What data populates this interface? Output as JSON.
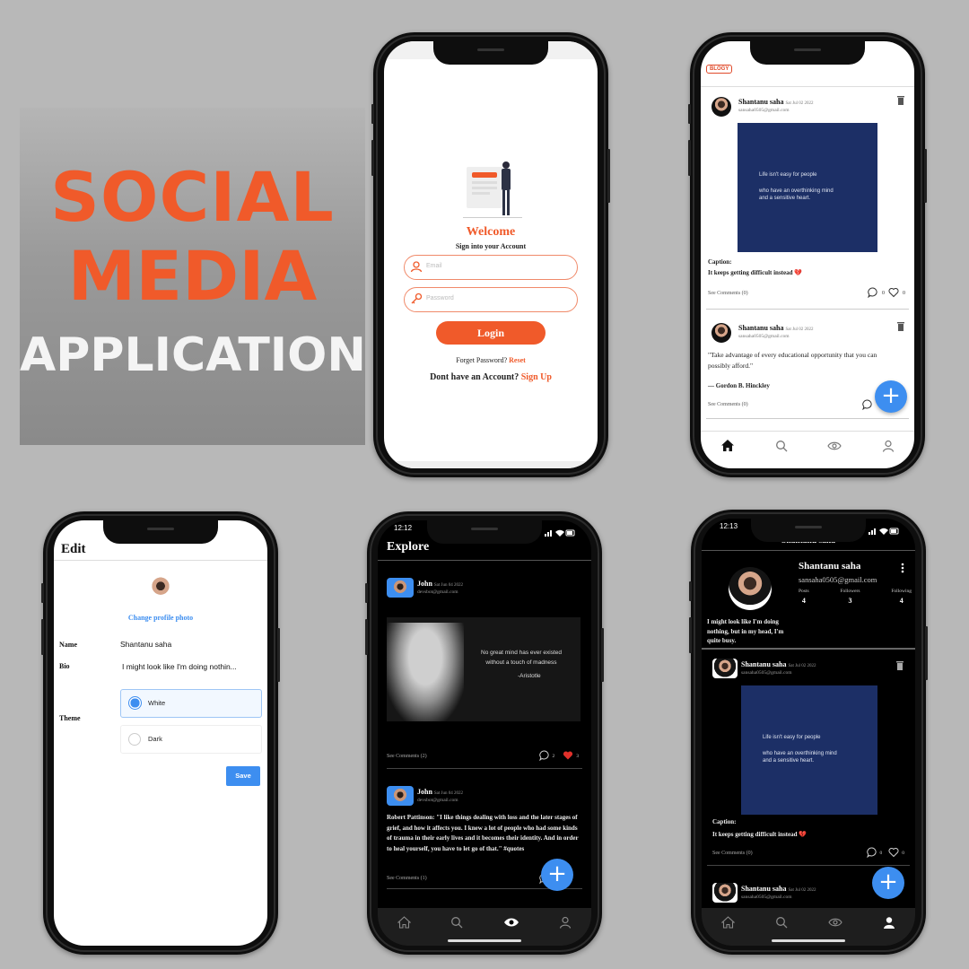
{
  "banner": {
    "line1": "SOCIAL",
    "line2": "MEDIA",
    "line3": "APPLICATION"
  },
  "login": {
    "heading": "Welcome",
    "subheading": "Sign into your Account",
    "email_placeholder": "Email",
    "password_placeholder": "Password",
    "login_label": "Login",
    "forgot_text": "Forget Password?",
    "reset_link": "Reset",
    "no_account_text": "Dont have an Account?",
    "signup_link": "Sign Up",
    "accent": "#f05a2a"
  },
  "feed": {
    "logo": "BLOGY",
    "post1": {
      "name": "Shantanu saha",
      "date": "Sat Jul 02 2022",
      "email": "sansaha0505@gmail.com",
      "quote_l1": "Life isn't easy for people",
      "quote_l2": "who have an overthinking mind",
      "quote_l3": "and a sensitive heart.",
      "caption_label": "Caption:",
      "caption": "It keeps getting difficult instead 💔",
      "see_comments": "See Comments (0)",
      "comments": "0",
      "likes": "0"
    },
    "post2": {
      "name": "Shantanu saha",
      "date": "Sat Jul 02 2022",
      "email": "sansaha0505@gmail.com",
      "text": "\"Take advantage of every educational opportunity that you can possibly afford.\"",
      "author": "— Gordon B. Hinckley",
      "see_comments": "See Comments (0)"
    },
    "tabs": [
      "home",
      "search",
      "explore",
      "profile"
    ]
  },
  "edit": {
    "title": "Edit",
    "change_photo": "Change profile photo",
    "name_label": "Name",
    "name_value": "Shantanu saha",
    "bio_label": "Bio",
    "bio_value": "I might look like I'm doing nothin...",
    "theme_label": "Theme",
    "theme_options": [
      "White",
      "Dark"
    ],
    "selected_theme": "White",
    "save_label": "Save"
  },
  "explore": {
    "time": "12:12",
    "title": "Explore",
    "post1": {
      "name": "John",
      "date": "Sat Jun 04 2022",
      "email": "devsbot@gmail.com",
      "quote_l1": "No great mind has ever existed",
      "quote_l2": "without a touch of madness",
      "quote_author": "-Aristotle",
      "see_comments": "See Comments (2)",
      "comments": "2",
      "likes": "3"
    },
    "post2": {
      "name": "John",
      "date": "Sat Jun 04 2022",
      "email": "devsbot@gmail.com",
      "text": "Robert Pattinson: \"I like things dealing with loss and the later stages of grief, and how it affects you. I knew a lot of people who had some kinds of trauma in their early lives and it becomes their identity. And in order to heal yourself, you have to let go of that.\" #quotes",
      "see_comments": "See Comments (1)"
    }
  },
  "profile": {
    "time": "12:13",
    "header": "Shantanu saha",
    "name": "Shantanu saha",
    "email": "sansaha0505@gmail.com",
    "stats": [
      {
        "label": "Posts",
        "value": "4"
      },
      {
        "label": "Followers",
        "value": "3"
      },
      {
        "label": "Following",
        "value": "4"
      }
    ],
    "bio": "I might look like I'm doing nothing, but in my head, I'm quite busy.",
    "post1": {
      "name": "Shantanu saha",
      "date": "Sat Jul 02 2022",
      "email": "sansaha0505@gmail.com",
      "quote_l1": "Life isn't easy for people",
      "quote_l2": "who have an overthinking mind",
      "quote_l3": "and a sensitive heart.",
      "caption_label": "Caption:",
      "caption": "It keeps getting difficult instead 💔",
      "see_comments": "See Comments (0)",
      "comments": "0",
      "likes": "0"
    },
    "post2": {
      "name": "Shantanu saha",
      "date": "Sat Jul 02 2022",
      "email": "sansaha0505@gmail.com"
    }
  }
}
